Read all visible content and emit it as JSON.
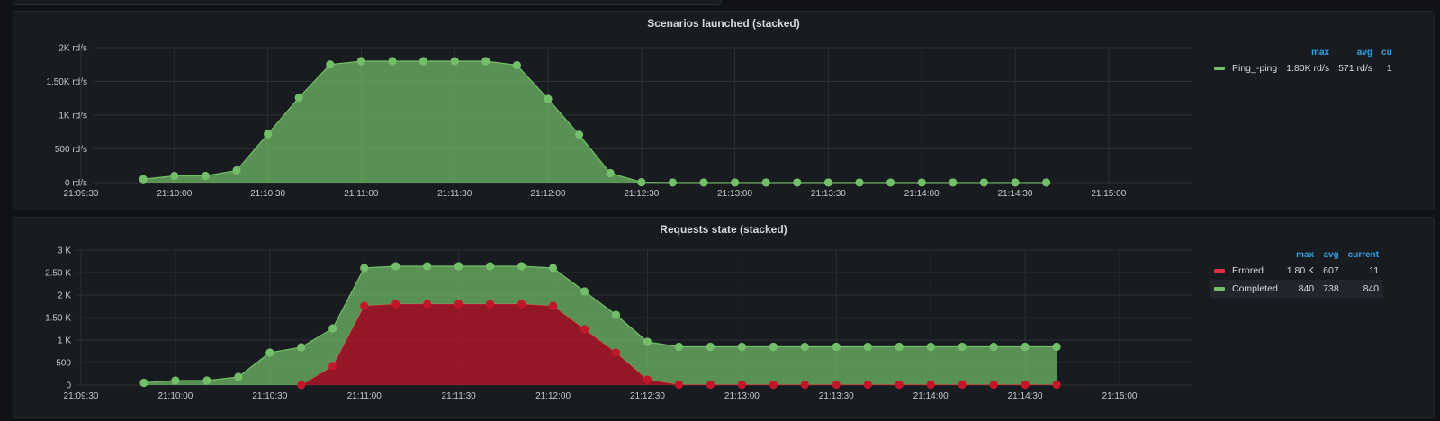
{
  "colors": {
    "green": "#73bf69",
    "red": "#c4162a",
    "grid": "#2c2f35"
  },
  "panels": [
    {
      "title": "Scenarios launched (stacked)",
      "legend_headers": [
        "max",
        "avg",
        "cu"
      ],
      "legend_rows": [
        {
          "name": "Ping_-ping",
          "color": "#73bf69",
          "values": [
            "1.80K rd/s",
            "571 rd/s",
            "1"
          ]
        }
      ]
    },
    {
      "title": "Requests state (stacked)",
      "legend_headers": [
        "max",
        "avg",
        "current"
      ],
      "legend_rows": [
        {
          "name": "Errored",
          "color": "#e02f44",
          "values": [
            "1.80 K",
            "607",
            "11"
          ]
        },
        {
          "name": "Completed",
          "color": "#73bf69",
          "values": [
            "840",
            "738",
            "840"
          ]
        }
      ]
    }
  ],
  "chart_data": [
    {
      "type": "area",
      "stacked": true,
      "title": "Scenarios launched (stacked)",
      "x_labels": [
        "21:09:30",
        "21:10:00",
        "21:10:30",
        "21:11:00",
        "21:11:30",
        "21:12:00",
        "21:12:30",
        "21:13:00",
        "21:13:30",
        "21:14:00",
        "21:14:30",
        "21:15:00"
      ],
      "y_ticks": [
        "0 rd/s",
        "500 rd/s",
        "1K rd/s",
        "1.50K rd/s",
        "2K rd/s"
      ],
      "ylim": [
        0,
        2000
      ],
      "grid": true,
      "legend_position": "right",
      "x_seconds": [
        20,
        30,
        40,
        50,
        60,
        70,
        80,
        90,
        100,
        110,
        120,
        130,
        140,
        150,
        160,
        170,
        180,
        190,
        200,
        210,
        220,
        230,
        240,
        250,
        260,
        270,
        280,
        290,
        300,
        310
      ],
      "series": [
        {
          "name": "Ping_-ping",
          "color": "#73bf69",
          "values": [
            50,
            100,
            100,
            180,
            720,
            1260,
            1750,
            1800,
            1800,
            1800,
            1800,
            1800,
            1740,
            1240,
            710,
            140,
            5,
            1,
            1,
            1,
            1,
            1,
            1,
            1,
            1,
            1,
            1,
            1,
            1,
            1
          ]
        }
      ]
    },
    {
      "type": "area",
      "stacked": true,
      "title": "Requests state (stacked)",
      "x_labels": [
        "21:09:30",
        "21:10:00",
        "21:10:30",
        "21:11:00",
        "21:11:30",
        "21:12:00",
        "21:12:30",
        "21:13:00",
        "21:13:30",
        "21:14:00",
        "21:14:30",
        "21:15:00"
      ],
      "y_ticks": [
        "0",
        "500",
        "1 K",
        "1.50 K",
        "2 K",
        "2.50 K",
        "3 K"
      ],
      "ylim": [
        0,
        3000
      ],
      "grid": true,
      "legend_position": "right",
      "x_seconds": [
        20,
        30,
        40,
        50,
        60,
        70,
        80,
        90,
        100,
        110,
        120,
        130,
        140,
        150,
        160,
        170,
        180,
        190,
        200,
        210,
        220,
        230,
        240,
        250,
        260,
        270,
        280,
        290,
        300,
        310
      ],
      "series": [
        {
          "name": "Errored",
          "color": "#c4162a",
          "values": [
            null,
            null,
            null,
            null,
            null,
            0,
            420,
            1760,
            1800,
            1800,
            1800,
            1800,
            1800,
            1760,
            1240,
            720,
            120,
            10,
            10,
            10,
            10,
            10,
            10,
            10,
            10,
            10,
            10,
            10,
            10,
            11
          ]
        },
        {
          "name": "Completed",
          "color": "#73bf69",
          "values": [
            50,
            100,
            100,
            180,
            720,
            840,
            840,
            840,
            840,
            840,
            840,
            840,
            840,
            840,
            840,
            840,
            840,
            840,
            840,
            840,
            840,
            840,
            840,
            840,
            840,
            840,
            840,
            840,
            840,
            840
          ]
        }
      ]
    }
  ]
}
